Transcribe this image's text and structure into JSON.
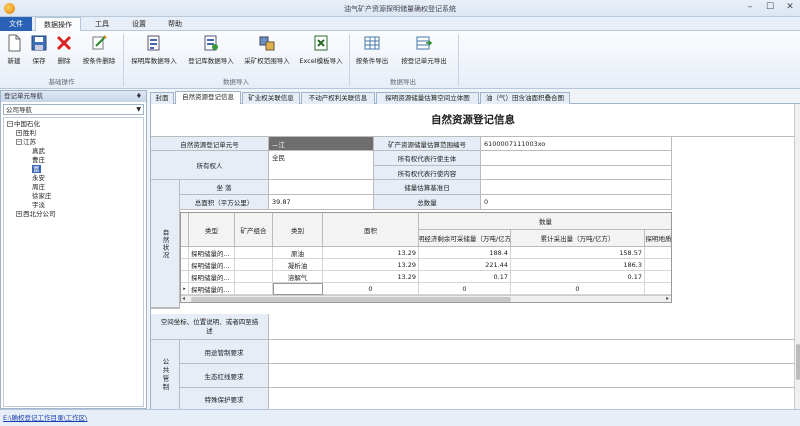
{
  "window": {
    "title": "油气矿产资源探明储量确权登记系统"
  },
  "menu": {
    "items": [
      "文件",
      "数据操作",
      "工具",
      "设置",
      "帮助"
    ]
  },
  "ribbon": {
    "groups": [
      {
        "label": "基础操作",
        "buttons": [
          "新建",
          "保存",
          "删除",
          "按条件删除"
        ]
      },
      {
        "label": "数据导入",
        "buttons": [
          "探明库数据导入",
          "登记库数据导入",
          "采矿权范围导入",
          "Excel模板导入"
        ]
      },
      {
        "label": "数据导出",
        "buttons": [
          "按条件导出",
          "按登记单元导出"
        ]
      }
    ]
  },
  "left_panel": {
    "title": "登记单元导航",
    "pin": "♦",
    "combo_value": "公司导航",
    "tree": {
      "root": "中国石化",
      "children": [
        "胜利",
        "江苏"
      ],
      "jiangsu_children": [
        "真武",
        "曹庄",
        "富",
        "永安",
        "周庄",
        "徐家庄",
        "宇淡"
      ],
      "other": "西北分公司"
    }
  },
  "tabs": [
    "封面",
    "自然资源登记信息",
    "矿业权关联信息",
    "不动产权利关联信息",
    "探明资源储量估算空间立体图",
    "油（气）田含油面积叠合图"
  ],
  "form": {
    "title": "自然资源登记信息",
    "unit_no_label": "自然资源登记单元号",
    "unit_no_value": "—江",
    "est_range_label": "矿产资源储量估算范围编号",
    "est_range_value": "6100007111003xo",
    "owner_label": "所有权人",
    "owner_value": "全民",
    "owner_rep_subject_label": "所有权代表行使主体",
    "owner_rep_content_label": "所有权代表行使内容",
    "nature_label": "自然状况",
    "location_label": "坐 落",
    "area_label": "总面积（平方公里）",
    "area_value": "39.87",
    "base_date_label": "储量估算基准日",
    "total_qty_label": "总数量",
    "total_qty_value": "0",
    "spatial_label": "空间坐标、位置说明、或者四至描述",
    "public_label": "公共管制",
    "usage_label": "用途管制要求",
    "eco_label": "生态红线要求",
    "special_label": "特殊保护要求"
  },
  "grid": {
    "headers": {
      "type": "类型",
      "combo": "矿产组合",
      "cat": "类别",
      "area": "面积",
      "qty": "数量",
      "q1": "探明经济剩余可采储量（万吨/亿方）",
      "q2": "累计采出量（万吨/亿方）",
      "q3": "探明地质"
    },
    "rows": [
      {
        "type": "探明储量的...",
        "cat": "原油",
        "area": "13.29",
        "q1": "188.4",
        "q2": "158.57"
      },
      {
        "type": "探明储量的...",
        "cat": "凝析油",
        "area": "13.29",
        "q1": "221.44",
        "q2": "186.3"
      },
      {
        "type": "探明储量的...",
        "cat": "溶解气",
        "area": "13.29",
        "q1": "0.17",
        "q2": "0.17"
      },
      {
        "type": "探明储量的...",
        "cat": "",
        "area": "0",
        "q1": "0",
        "q2": "0"
      }
    ]
  },
  "status": {
    "path": "E:\\确权登记工作目录\\工作区\\"
  }
}
